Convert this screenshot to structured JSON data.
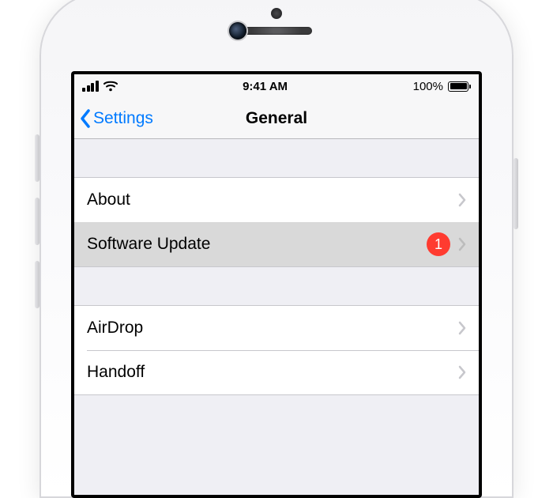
{
  "status": {
    "time": "9:41 AM",
    "battery_percent": "100%"
  },
  "nav": {
    "back_label": "Settings",
    "title": "General"
  },
  "groups": [
    {
      "rows": [
        {
          "key": "about",
          "label": "About",
          "selected": false
        },
        {
          "key": "swupdate",
          "label": "Software Update",
          "selected": true,
          "badge": "1"
        }
      ]
    },
    {
      "rows": [
        {
          "key": "airdrop",
          "label": "AirDrop",
          "selected": false
        },
        {
          "key": "handoff",
          "label": "Handoff",
          "selected": false
        }
      ]
    }
  ]
}
